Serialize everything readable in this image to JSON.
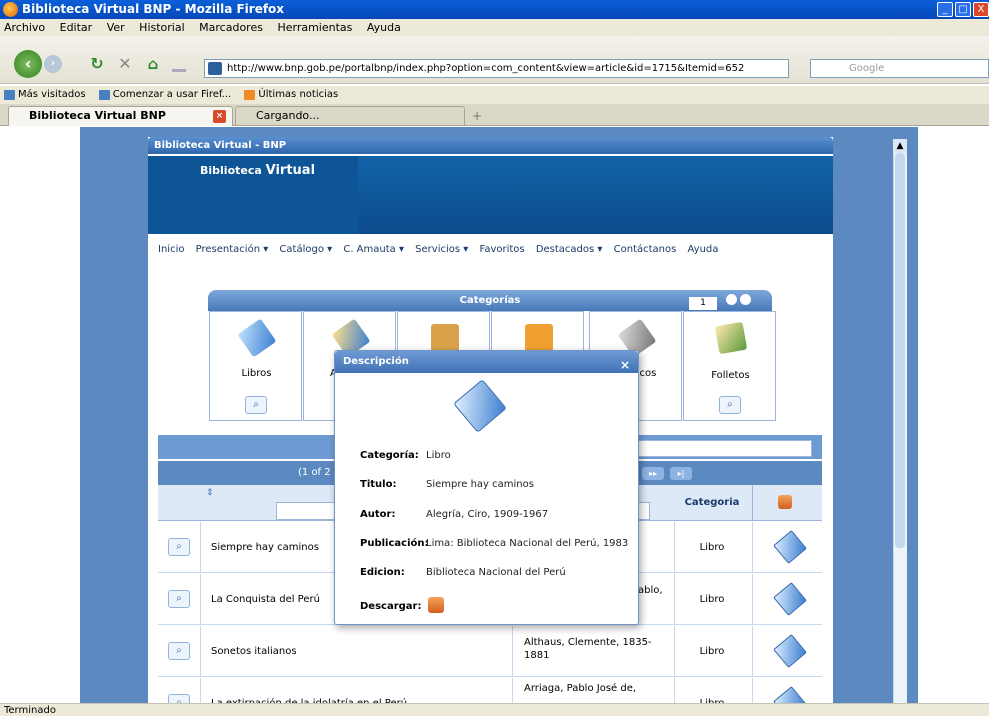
{
  "window": {
    "title": "Biblioteca Virtual BNP - Mozilla Firefox",
    "minimize": "_",
    "maximize": "□",
    "close": "X"
  },
  "menubar": [
    "Archivo",
    "Editar",
    "Ver",
    "Historial",
    "Marcadores",
    "Herramientas",
    "Ayuda"
  ],
  "toolbar": {
    "url": "http://www.bnp.gob.pe/portalbnp/index.php?option=com_content&view=article&id=1715&Itemid=652",
    "search_placeholder": "Google"
  },
  "bookmarks": [
    "Más visitados",
    "Comenzar a usar Firef...",
    "Últimas noticias"
  ],
  "tabs": [
    {
      "label": "Biblioteca Virtual BNP"
    },
    {
      "label": "Cargando..."
    }
  ],
  "status": "Terminado",
  "site": {
    "title": "Biblioteca Virtual - BNP",
    "logo_line1": "Biblioteca",
    "logo_line2": "Virtual",
    "menu": [
      "Inicio",
      "Presentación ▾",
      "Catálogo ▾",
      "C. Amauta ▾",
      "Servicios ▾",
      "Favoritos",
      "Destacados ▾",
      "Contáctanos",
      "Ayuda"
    ]
  },
  "categories": {
    "header": "Categorías",
    "pager": "1",
    "items": [
      "Libros",
      "A",
      "",
      "",
      "licos",
      "Folletos"
    ]
  },
  "table": {
    "pager_text": "(1 of 2",
    "col_category": "Categoria",
    "rows": [
      {
        "title": "Siempre hay caminos",
        "author": "",
        "category": "Libro"
      },
      {
        "title": "La Conquista del Perú",
        "author": "ablo,",
        "category": "Libro"
      },
      {
        "title": "Sonetos italianos",
        "author": "Althaus, Clemente, 1835-1881",
        "category": "Libro"
      },
      {
        "title": "La extirpación de la idolatría en el Perú",
        "author": "Arriaga, Pablo José de,",
        "category": "Libro"
      }
    ]
  },
  "modal": {
    "title": "Descripción",
    "close": "×",
    "fields": [
      {
        "label": "Categoría:",
        "value": "Libro"
      },
      {
        "label": "Titulo:",
        "value": "Siempre hay caminos"
      },
      {
        "label": "Autor:",
        "value": "Alegría, Ciro, 1909-1967"
      },
      {
        "label": "Publicación:",
        "value": "Lima: Biblioteca Nacional del Perú, 1983"
      },
      {
        "label": "Edicion:",
        "value": "Biblioteca Nacional del Perú"
      }
    ],
    "download_label": "Descargar:"
  }
}
